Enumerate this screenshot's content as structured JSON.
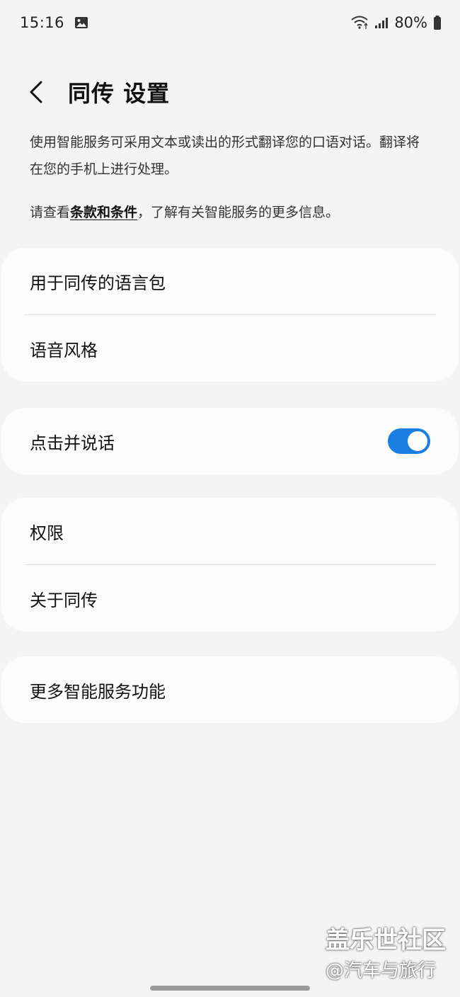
{
  "status_bar": {
    "time": "15:16",
    "battery": "80%",
    "icons": [
      "image-icon",
      "wifi-icon",
      "signal-icon",
      "battery-icon"
    ]
  },
  "header": {
    "back_icon": "chevron-left-icon",
    "title": "同传 设置"
  },
  "intro": {
    "description": "使用智能服务可采用文本或读出的形式翻译您的口语对话。翻译将在您的手机上进行处理。",
    "terms_prefix": "请查看",
    "terms_link": "条款和条件",
    "terms_suffix": "，了解有关智能服务的更多信息。"
  },
  "cards": {
    "language_pack": "用于同传的语言包",
    "voice_style": "语音风格",
    "tap_to_talk": "点击并说话",
    "tap_to_talk_enabled": true,
    "permissions": "权限",
    "about": "关于同传",
    "more_features": "更多智能服务功能"
  },
  "colors": {
    "accent": "#1b7ee0",
    "background": "#f4f4f4",
    "card": "#fcfcfc"
  },
  "watermark": {
    "brand": "盖乐世社区",
    "handle": "@汽车与旅行"
  }
}
